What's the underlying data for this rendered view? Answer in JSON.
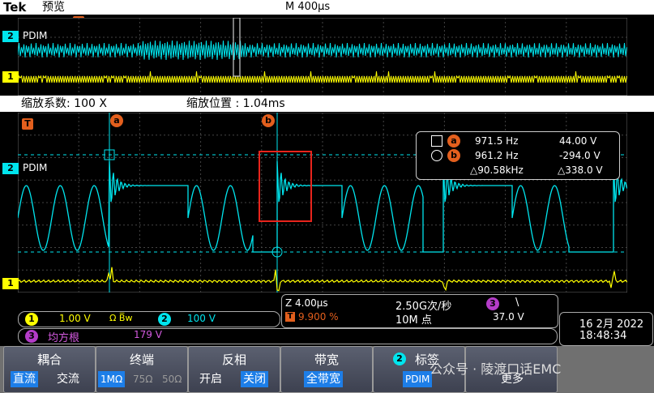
{
  "header": {
    "brand": "Tek",
    "mode": "预览",
    "timebase": "M 400μs"
  },
  "zoom": {
    "factor": "缩放系数: 100 X",
    "position": "缩放位置 : 1.04ms"
  },
  "markers": {
    "trigger": "T",
    "cursor_a": "a",
    "cursor_b": "b",
    "ch1": "1",
    "ch2": "2"
  },
  "channels": {
    "ch2_label": "PDIM",
    "ch2_label_main": "PDIM"
  },
  "measurements": {
    "a_freq": "971.5 Hz",
    "a_volt": "44.00 V",
    "b_freq": "961.2 Hz",
    "b_volt": "-294.0 V",
    "delta_freq": "△90.58kHz",
    "delta_volt": "△338.0 V"
  },
  "status": {
    "ch1_num": "1",
    "ch1_scale": "1.00 V",
    "ch1_coupling": "Ω B̅w",
    "ch2_num": "2",
    "ch2_scale": "100 V",
    "zoom_scale": "Z 4.00μs",
    "sample_rate": "2.50G次/秒",
    "trig_ch": "3",
    "trig_slope": "\\",
    "trig_pos": "9.900 %",
    "trig_marker": "T",
    "record": "10M 点",
    "trig_level": "37.0 V",
    "date": "16 2月 2022",
    "time": "18:48:34",
    "math_num": "3",
    "math_func": "均方根",
    "math_value": "179 V"
  },
  "menu": [
    {
      "title": "耦合",
      "options": [
        "直流",
        "交流"
      ]
    },
    {
      "title": "终端",
      "options": [
        "1MΩ",
        "75Ω",
        "50Ω"
      ]
    },
    {
      "title": "反相",
      "options": [
        "开启",
        "关闭"
      ]
    },
    {
      "title": "带宽",
      "options": [
        "全带宽"
      ]
    },
    {
      "title": "标签",
      "options": [
        "PDIM"
      ],
      "badge": "2"
    },
    {
      "title": "",
      "options": [
        "更多"
      ]
    }
  ],
  "watermark": "公众号 · 陵渡口话EMC",
  "colors": {
    "ch1": "#ffff00",
    "ch2": "#00e5ee",
    "cursor": "#e35f1d",
    "math": "#b43cc8",
    "selected": "#1d7ee8"
  }
}
